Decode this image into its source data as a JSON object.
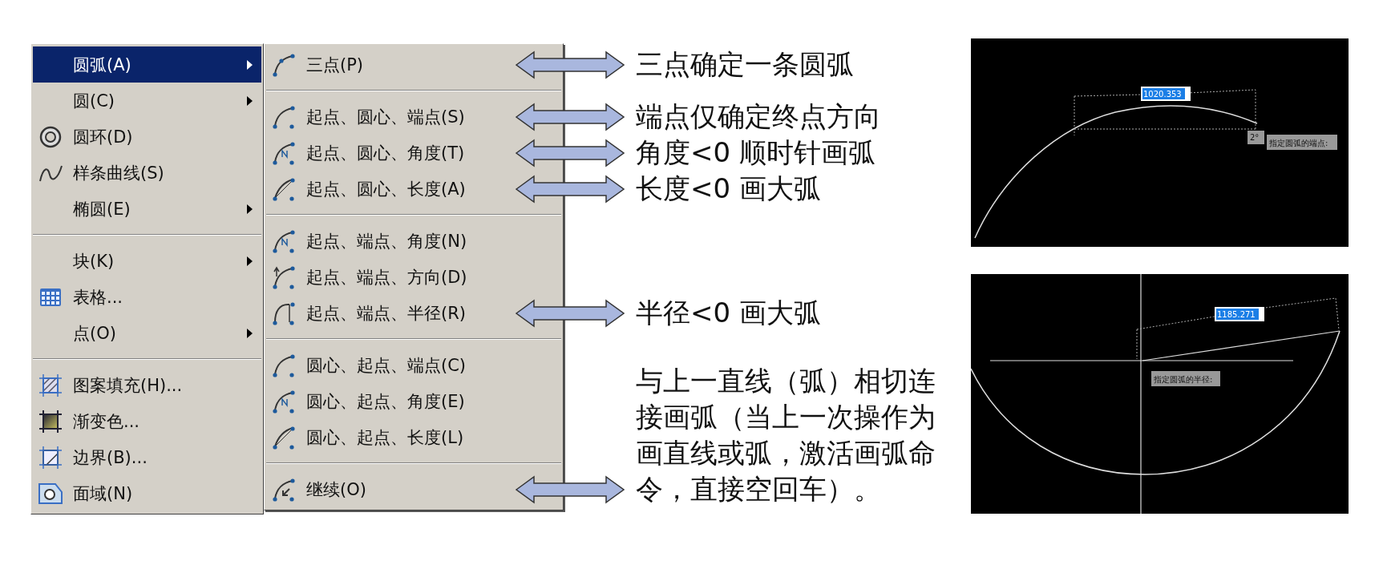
{
  "menu": {
    "groups": [
      [
        {
          "label": "圆弧(A)",
          "selected": true,
          "submenu": true
        },
        {
          "label": "圆(C)",
          "selected": false,
          "submenu": true
        },
        {
          "label": "圆环(D)",
          "selected": false,
          "submenu": false
        },
        {
          "label": "样条曲线(S)",
          "selected": false,
          "submenu": false
        },
        {
          "label": "椭圆(E)",
          "selected": false,
          "submenu": true
        }
      ],
      [
        {
          "label": "块(K)",
          "selected": false,
          "submenu": true
        },
        {
          "label": "表格...",
          "selected": false,
          "submenu": false
        },
        {
          "label": "点(O)",
          "selected": false,
          "submenu": true
        }
      ],
      [
        {
          "label": "图案填充(H)...",
          "selected": false,
          "submenu": false
        },
        {
          "label": "渐变色...",
          "selected": false,
          "submenu": false
        },
        {
          "label": "边界(B)...",
          "selected": false,
          "submenu": false
        },
        {
          "label": "面域(N)",
          "selected": false,
          "submenu": false
        }
      ]
    ]
  },
  "submenu": {
    "groups": [
      [
        {
          "label": "三点(P)",
          "note": "三点确定一条圆弧"
        }
      ],
      [
        {
          "label": "起点、圆心、端点(S)",
          "note": "端点仅确定终点方向"
        },
        {
          "label": "起点、圆心、角度(T)",
          "note": "角度<0 顺时针画弧"
        },
        {
          "label": "起点、圆心、长度(A)",
          "note": "长度<0 画大弧"
        }
      ],
      [
        {
          "label": "起点、端点、角度(N)"
        },
        {
          "label": "起点、端点、方向(D)"
        },
        {
          "label": "起点、端点、半径(R)",
          "note": "半径<0 画大弧"
        }
      ],
      [
        {
          "label": "圆心、起点、端点(C)"
        },
        {
          "label": "圆心、起点、角度(E)"
        },
        {
          "label": "圆心、起点、长度(L)"
        }
      ],
      [
        {
          "label": "继续(O)",
          "note": "与上一直线（弧）相切连接画弧（当上一次操作为画直线或弧，激活画弧命令，直接空回车）。"
        }
      ]
    ]
  },
  "screens": [
    {
      "kind": "endpoint",
      "dimension_value": "1020.353",
      "angle": "2°",
      "prompt": "指定圆弧的端点:"
    },
    {
      "kind": "radius",
      "dimension_value": "1185.271",
      "prompt": "指定圆弧的半径:"
    }
  ]
}
